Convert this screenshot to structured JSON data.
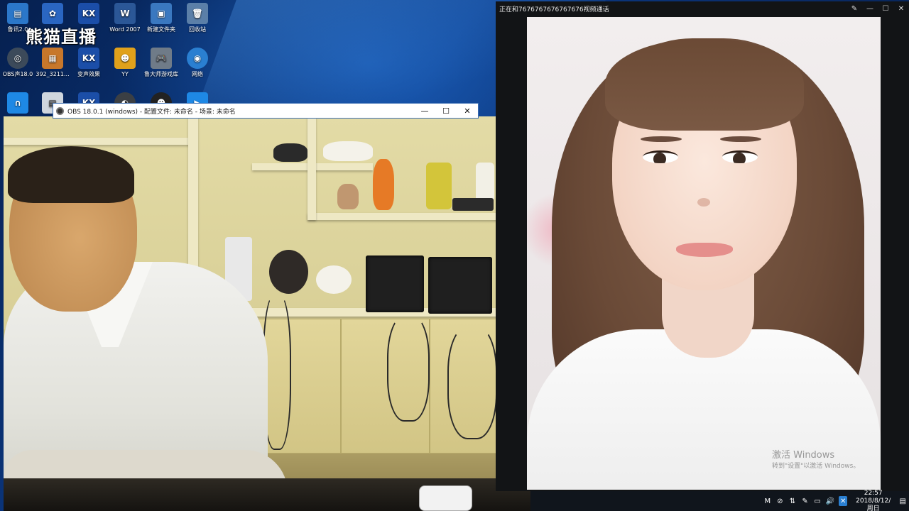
{
  "desktop": {
    "icons": [
      {
        "label": "鲁讯2.0",
        "symbol": "▤",
        "color": "#2b77c9"
      },
      {
        "label": "",
        "symbol": "✿",
        "color": "#2a66c2"
      },
      {
        "label": "",
        "symbol": "KX",
        "color": "#1b4ea8"
      },
      {
        "label": "Word 2007",
        "symbol": "W",
        "color": "#2b5797"
      },
      {
        "label": "新建文件夹",
        "symbol": "▣",
        "color": "#3a78c0"
      },
      {
        "label": "回收站",
        "symbol": "🗑",
        "color": "#5b7fa8"
      },
      {
        "label": "OBS声18.0",
        "symbol": "◎",
        "color": "#3c4a5a"
      },
      {
        "label": "392_3211...",
        "symbol": "▦",
        "color": "#c7772b"
      },
      {
        "label": "变声效果",
        "symbol": "KX",
        "color": "#1b4ea8"
      },
      {
        "label": "YY",
        "symbol": "☻",
        "color": "#e0a11b"
      },
      {
        "label": "鲁大师游戏库",
        "symbol": "🎮",
        "color": "#6f7b88"
      },
      {
        "label": "网络",
        "symbol": "◉",
        "color": "#2a7fd1"
      },
      {
        "label": "",
        "symbol": "∩",
        "color": "#1e88e5"
      },
      {
        "label": "",
        "symbol": "▤",
        "color": "#cfd6de"
      },
      {
        "label": "",
        "symbol": "KX",
        "color": "#1b4ea8"
      },
      {
        "label": "",
        "symbol": "◐",
        "color": "#3b3f44"
      },
      {
        "label": "",
        "symbol": "☻",
        "color": "#222"
      },
      {
        "label": "",
        "symbol": "▶",
        "color": "#1e88e5"
      }
    ],
    "overlay_logo": "熊猫直播"
  },
  "obs_window": {
    "title": "OBS 18.0.1 (windows) - 配置文件: 未命名 - 场景: 未命名",
    "minimize": "—",
    "maximize": "☐",
    "close": "✕"
  },
  "call_window": {
    "title": "正在和7676767676767676视频通话",
    "pin": "✎",
    "minimize": "—",
    "maximize": "☐",
    "close": "✕"
  },
  "activation_notice": {
    "title": "激活 Windows",
    "subtitle": "转到\"设置\"以激活 Windows。"
  },
  "tray": {
    "icons": [
      "M",
      "⊘",
      "⇅",
      "✎",
      "▭",
      "🔊",
      "✕"
    ],
    "time": "22:57",
    "date": "2018/8/12/周日",
    "notification_symbol": "▤"
  }
}
